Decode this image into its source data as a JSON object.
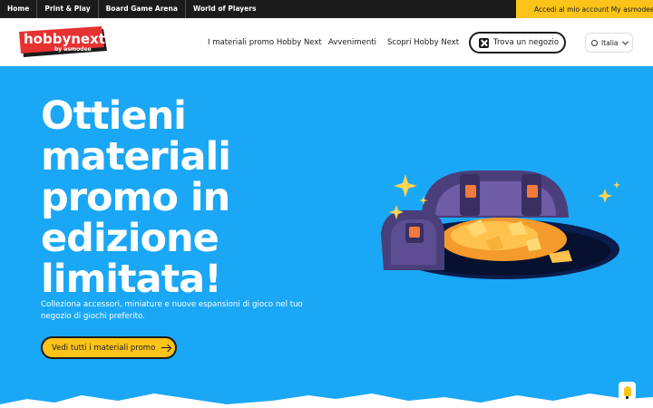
{
  "topbar": {
    "links": [
      "Home",
      "Print & Play",
      "Board Game Arena",
      "World of Players"
    ],
    "account_label": "Accedi al mio account My asmodee",
    "account_icon": "user-icon"
  },
  "header": {
    "logo_text": "hobbynext",
    "logo_sub": "by asmodee",
    "nav": [
      "I materiali promo Hobby Next",
      "Avvenimenti",
      "Scopri Hobby Next"
    ],
    "store_button": "Trova un negozio",
    "language": "Italia"
  },
  "hero": {
    "title_lines": [
      "Ottieni",
      "materiali",
      "promo in",
      "edizione",
      "limitata!"
    ],
    "subtitle": "Colleziona accessori, miniature e nuove espansioni di gioco nel tuo negozio di giochi preferito.",
    "cta_label": "Vedi tutti i materiali promo"
  },
  "colors": {
    "hero_bg": "#1aa7f5",
    "accent": "#fcc419",
    "dark": "#1b1b1b"
  }
}
